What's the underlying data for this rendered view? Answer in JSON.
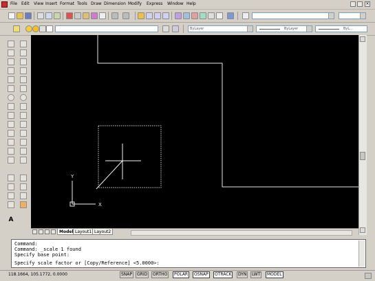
{
  "menu": {
    "items": [
      "File",
      "Edit",
      "View",
      "Insert",
      "Format",
      "Tools",
      "Draw",
      "Dimension",
      "Modify",
      "Express",
      "Window",
      "Help"
    ]
  },
  "layers_bar": {
    "layer_combo_value": "",
    "color_combo_value": "ByLayer",
    "linetype_combo_value": "ByLayer",
    "lineweight_combo_value": "ByL..."
  },
  "canvas": {
    "ucs_y_label": "Y",
    "ucs_x_label": "X"
  },
  "tabs": [
    "Model",
    "Layout1",
    "Layout2"
  ],
  "command": {
    "lines": [
      "Command:",
      "Command: _scale 1 found",
      "Specify base point:",
      "Specify scale factor or [Copy/Reference] <5.0000>:"
    ]
  },
  "status": {
    "coordinates": "118.1664, 105.1772, 0.0000",
    "toggles": [
      {
        "label": "SNAP",
        "on": false
      },
      {
        "label": "GRID",
        "on": false
      },
      {
        "label": "ORTHO",
        "on": false
      },
      {
        "label": "POLAR",
        "on": true
      },
      {
        "label": "OSNAP",
        "on": true
      },
      {
        "label": "OTRACK",
        "on": true
      },
      {
        "label": "DYN",
        "on": false
      },
      {
        "label": "LWT",
        "on": false
      },
      {
        "label": "MODEL",
        "on": true
      }
    ]
  },
  "colors": {
    "canvas_bg": "#000000",
    "ui_face": "#d4d0c8"
  }
}
